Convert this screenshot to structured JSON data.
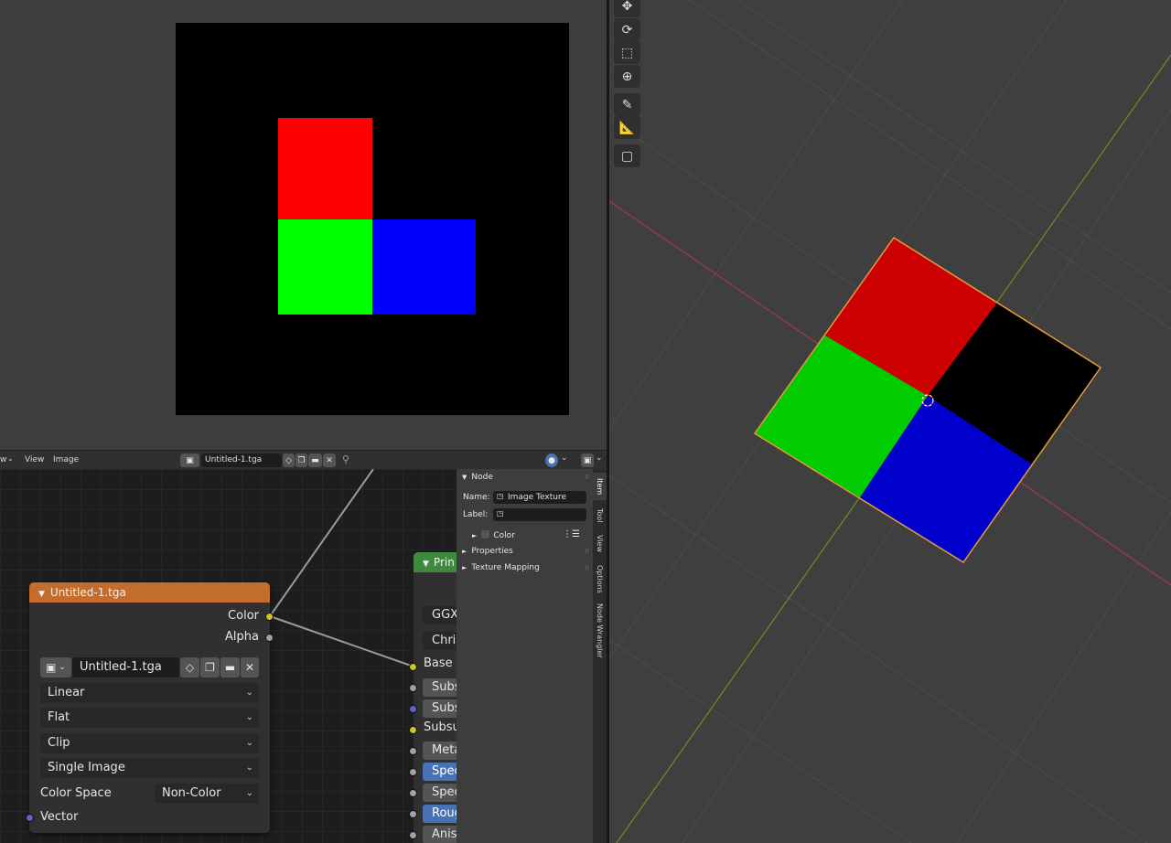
{
  "image_editor": {
    "header": {
      "view_menu_partial": "w",
      "menus": [
        "View",
        "Image"
      ],
      "image_name": "Untitled-1.tga"
    },
    "colors": {
      "red": "#ff0000",
      "green": "#00ff00",
      "blue": "#0000ff",
      "background": "#000000"
    }
  },
  "image_node": {
    "title": "Untitled-1.tga",
    "outputs": [
      "Color",
      "Alpha"
    ],
    "image_name": "Untitled-1.tga",
    "interpolation": "Linear",
    "projection": "Flat",
    "extension": "Clip",
    "source": "Single Image",
    "color_space_label": "Color Space",
    "color_space": "Non-Color",
    "input_vector": "Vector"
  },
  "bsdf_node": {
    "title": "Prin",
    "distribution": "GGX",
    "subsurface_method": "Chris",
    "inputs": [
      "Base C",
      "Subs",
      "Subs",
      "Subsu",
      "Meta",
      "Spec",
      "Spec",
      "Roug",
      "Anis"
    ]
  },
  "sidebar": {
    "panel_node": "Node",
    "name_label": "Name:",
    "name_value": "Image Texture",
    "label_label": "Label:",
    "label_value": "",
    "color_sub": "Color",
    "properties": "Properties",
    "texture_mapping": "Texture Mapping",
    "tabs": [
      "Item",
      "Tool",
      "View",
      "Options",
      "Node Wrangler"
    ]
  },
  "viewport": {
    "tools": [
      "move-icon",
      "rotate-icon",
      "scale-icon",
      "transform-icon",
      "annotate-icon",
      "measure-icon",
      "add-cube-icon"
    ],
    "plane_colors": {
      "red": "#cc0000",
      "black": "#000000",
      "green": "#00cc00",
      "blue": "#0000cc",
      "outline": "#e89a3c"
    }
  }
}
